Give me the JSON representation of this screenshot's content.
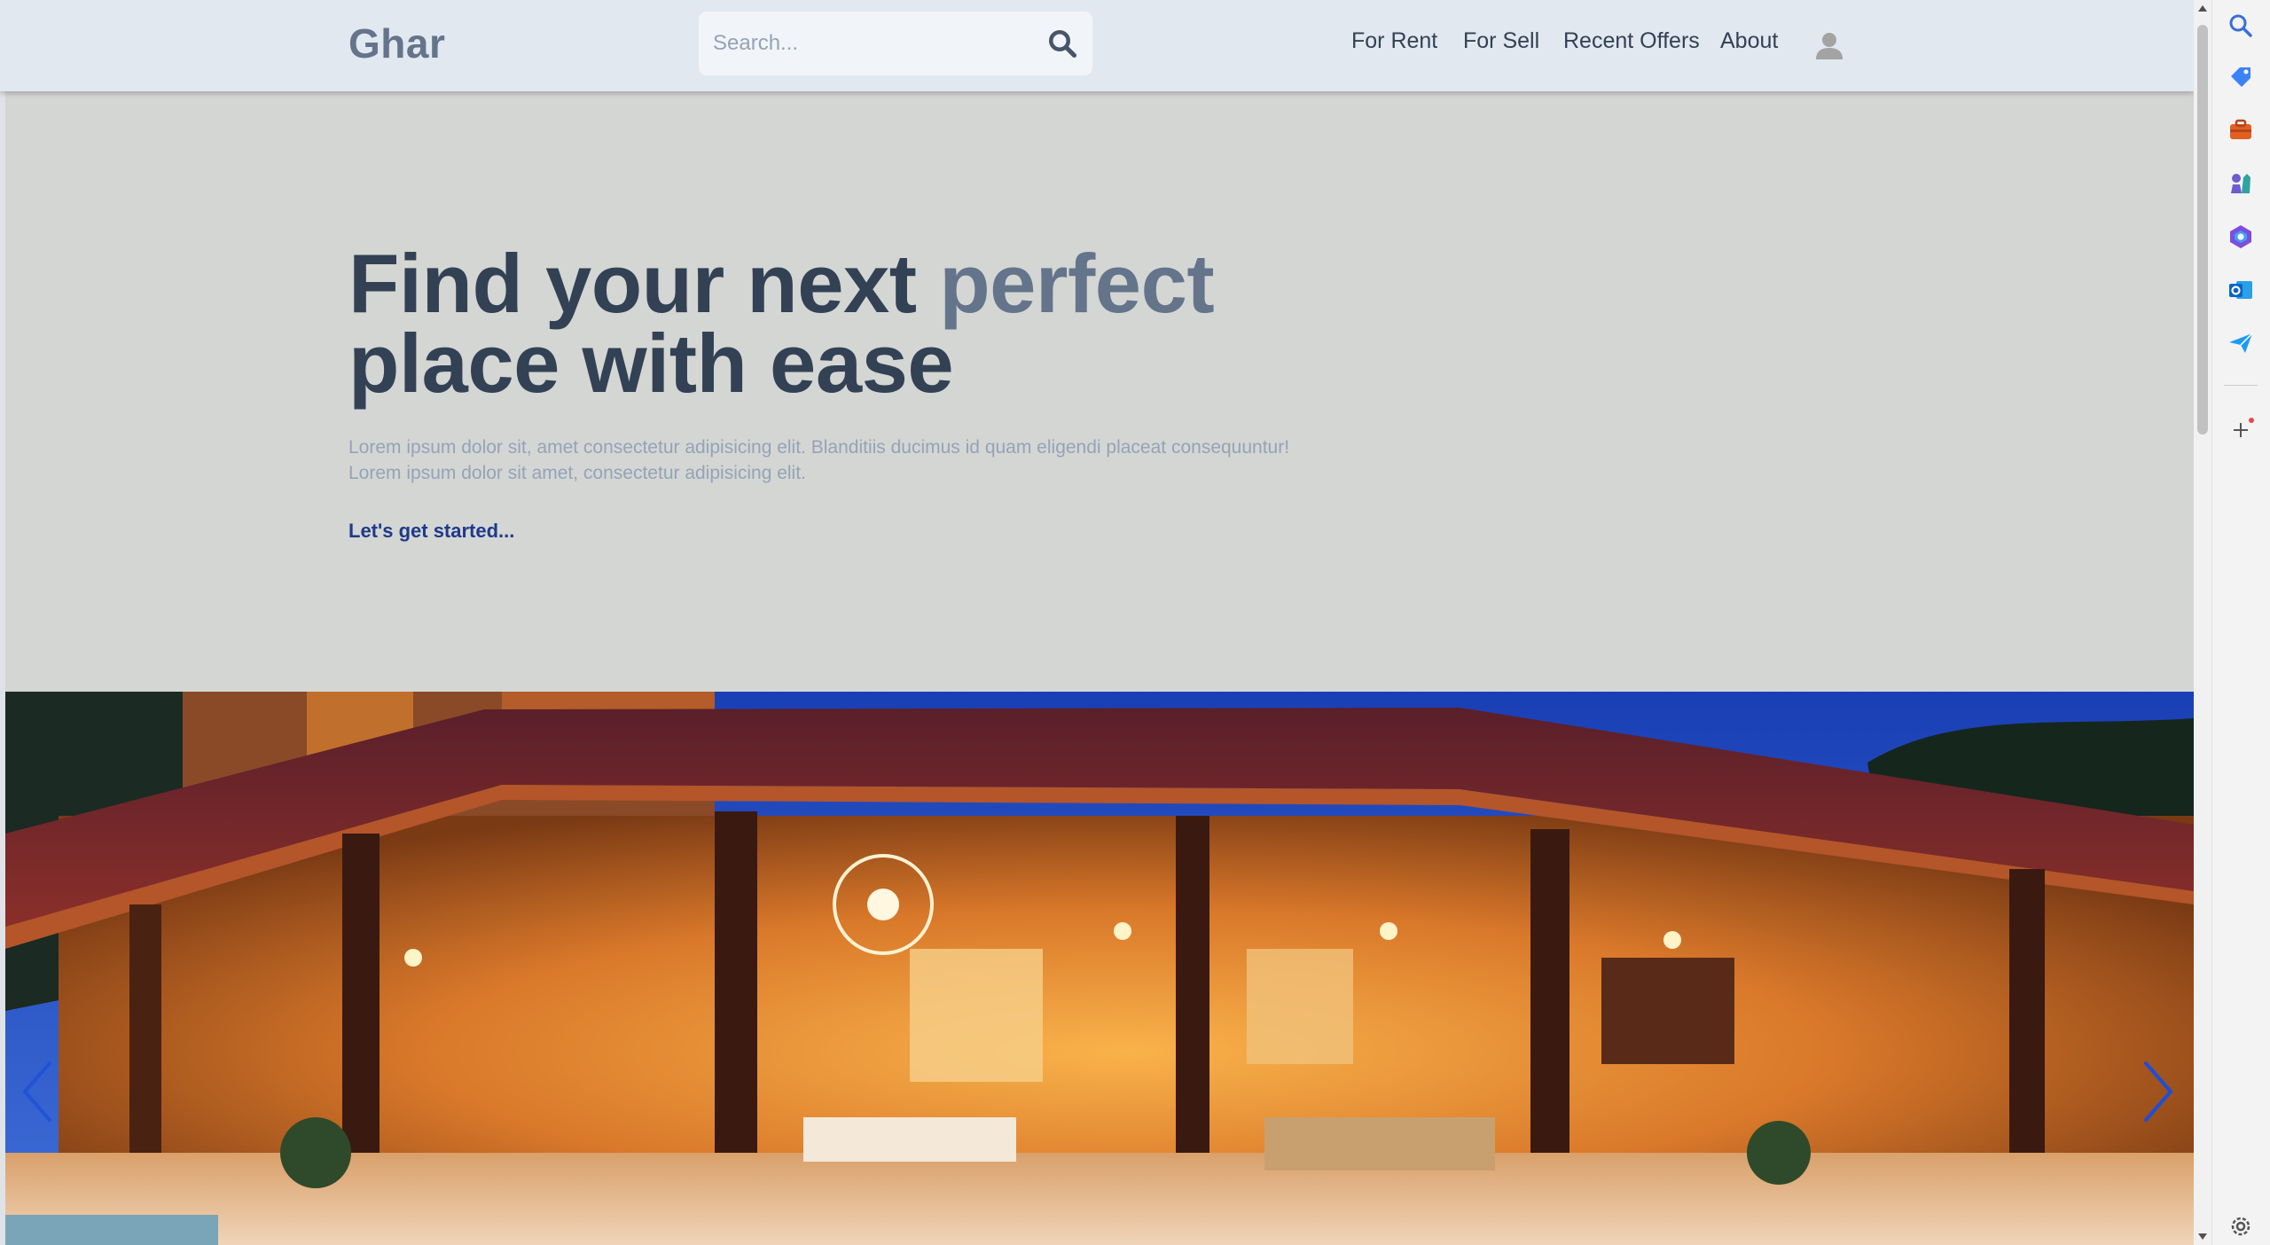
{
  "header": {
    "logo": "Ghar",
    "search_placeholder": "Search...",
    "nav": [
      "For Rent",
      "For Sell",
      "Recent Offers",
      "About"
    ]
  },
  "hero": {
    "title_part1": "Find your next ",
    "title_accent": "perfect",
    "title_part2": "place with ease",
    "description_line1": "Lorem ipsum dolor sit, amet consectetur adipisicing elit. Blanditiis ducimus id quam eligendi placeat consequuntur!",
    "description_line2": "Lorem ipsum dolor sit amet, consectetur adipisicing elit.",
    "cta": "Let's get started..."
  },
  "carousel": {
    "prev_icon": "chevron-left-icon",
    "next_icon": "chevron-right-icon"
  },
  "edge_sidebar": {
    "icons": [
      "search-icon",
      "tag-icon",
      "briefcase-icon",
      "chess-icon",
      "copilot-icon",
      "outlook-icon",
      "send-icon",
      "add-icon",
      "settings-icon"
    ]
  },
  "colors": {
    "header_bg": "#e2e8f0",
    "page_bg": "#d4d6d3",
    "heading": "#334155",
    "accent": "#64748b",
    "muted": "#94a3b8",
    "cta": "#1e3a8a",
    "arrow": "#1d4ed8"
  }
}
